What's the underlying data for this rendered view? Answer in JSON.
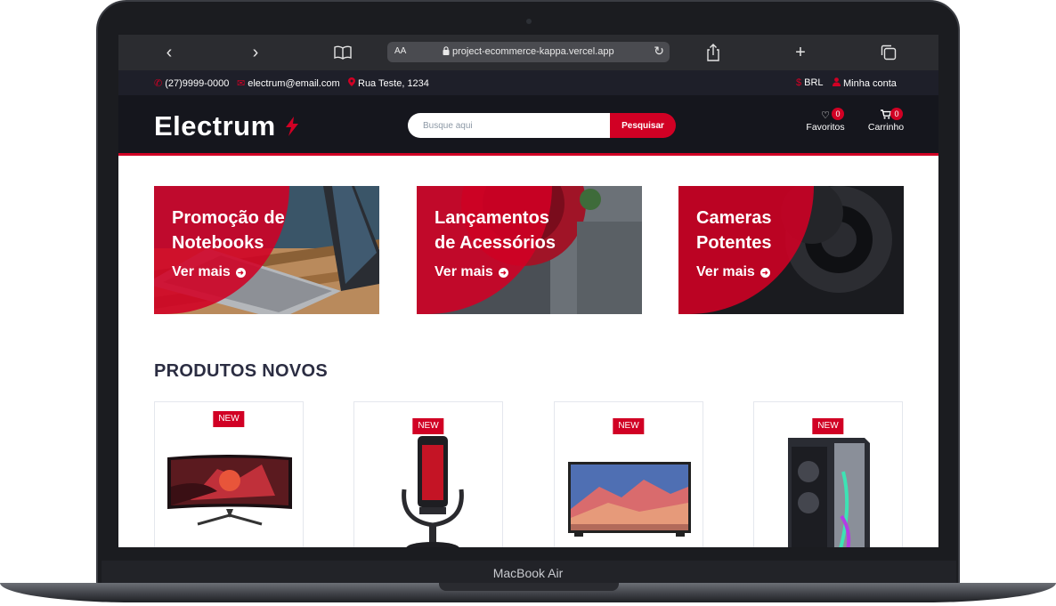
{
  "device": {
    "label": "MacBook Air"
  },
  "browser": {
    "text_size_label": "AA",
    "url": "project-ecommerce-kappa.vercel.app"
  },
  "info_bar": {
    "phone": "(27)9999-0000",
    "email": "electrum@email.com",
    "address": "Rua Teste, 1234",
    "currency": "BRL",
    "account": "Minha conta"
  },
  "header": {
    "logo": "Electrum",
    "search_placeholder": "Busque aqui",
    "search_button": "Pesquisar",
    "favorites_label": "Favoritos",
    "favorites_count": "0",
    "cart_label": "Carrinho",
    "cart_count": "0"
  },
  "banners": [
    {
      "title_line1": "Promoção de",
      "title_line2": "Notebooks",
      "link": "Ver mais"
    },
    {
      "title_line1": "Lançamentos",
      "title_line2": "de Acessórios",
      "link": "Ver mais"
    },
    {
      "title_line1": "Cameras",
      "title_line2": "Potentes",
      "link": "Ver mais"
    }
  ],
  "section": {
    "title": "PRODUTOS NOVOS"
  },
  "products": [
    {
      "badge": "NEW",
      "image": "curved-monitor"
    },
    {
      "badge": "NEW",
      "image": "microphone"
    },
    {
      "badge": "NEW",
      "image": "television"
    },
    {
      "badge": "NEW",
      "image": "pc-case"
    }
  ],
  "colors": {
    "accent": "#d10024",
    "header_bg": "#15161d",
    "info_bg": "#1e1f29"
  }
}
